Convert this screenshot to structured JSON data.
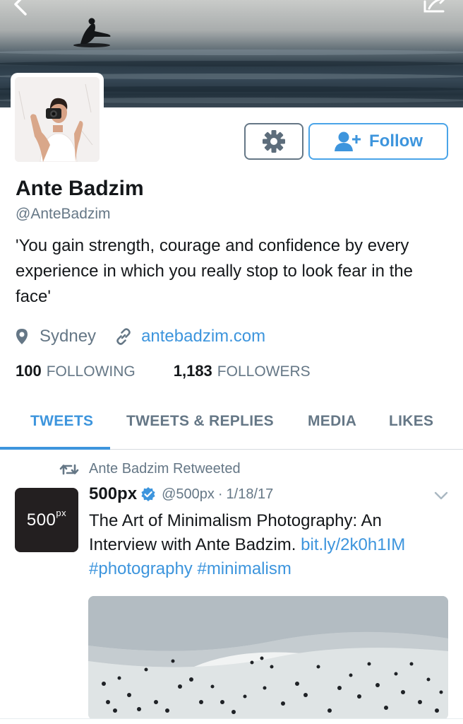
{
  "profile": {
    "name": "Ante Badzim",
    "handle": "@AnteBadzim",
    "bio": "'You gain strength, courage and confidence by every experience in which you really stop to look fear in the face'",
    "location": "Sydney",
    "website": "antebadzim.com",
    "following_count": "100",
    "following_label": "FOLLOWING",
    "followers_count": "1,183",
    "followers_label": "FOLLOWERS"
  },
  "actions": {
    "settings_icon": "gear-icon",
    "follow_label": "Follow",
    "follow_icon": "add-user-icon"
  },
  "tabs": [
    {
      "label": "TWEETS",
      "active": true
    },
    {
      "label": "TWEETS & REPLIES",
      "active": false
    },
    {
      "label": "MEDIA",
      "active": false
    },
    {
      "label": "LIKES",
      "active": false
    }
  ],
  "tweet": {
    "retweet_text": "Ante Badzim Retweeted",
    "avatar_text": "500",
    "avatar_sup": "px",
    "author_name": "500px",
    "author_handle": "@500px",
    "separator": "·",
    "date": "1/18/17",
    "text_prefix": "The Art of Minimalism Photography: An Interview with Ante Badzim. ",
    "link": "bit.ly/2k0h1IM",
    "hashtag1": "#photography",
    "hashtag2": "#minimalism"
  },
  "colors": {
    "accent": "#3d95dd",
    "secondary_text": "#657786",
    "primary_text": "#14171a"
  }
}
